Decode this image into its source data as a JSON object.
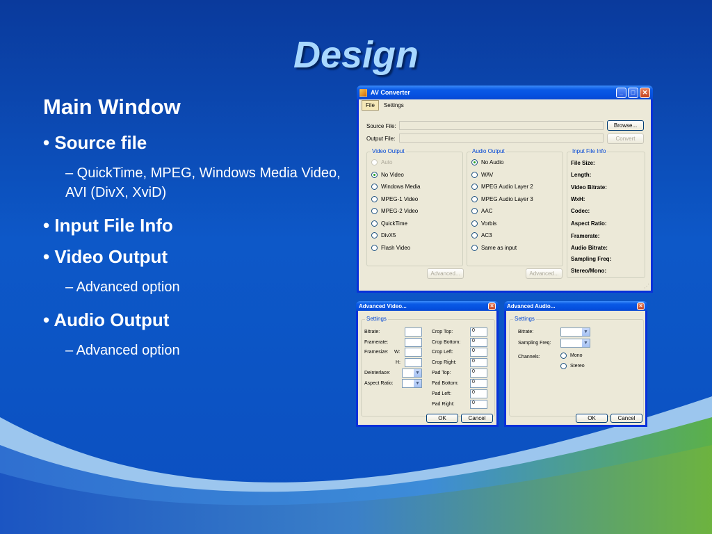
{
  "slide": {
    "title": "Design",
    "heading": "Main Window",
    "bullets": [
      {
        "text": "• Source file",
        "sub": "– QuickTime, MPEG, Windows Media Video, AVI (DivX, XviD)"
      },
      {
        "text": "• Input File Info",
        "sub": ""
      },
      {
        "text": "• Video Output",
        "sub": "– Advanced option"
      },
      {
        "text": "• Audio Output",
        "sub": "– Advanced option"
      }
    ]
  },
  "main_window": {
    "title": "AV Converter",
    "menu": [
      "File",
      "Settings"
    ],
    "source_label": "Source File:",
    "output_label": "Output File:",
    "browse": "Browse...",
    "convert": "Convert",
    "video_group": "Video Output",
    "video_options": [
      "Auto",
      "No Video",
      "Windows Media",
      "MPEG-1 Video",
      "MPEG-2 Video",
      "QuickTime",
      "DivX5",
      "Flash Video"
    ],
    "audio_group": "Audio Output",
    "audio_options": [
      "No Audio",
      "WAV",
      "MPEG Audio Layer 2",
      "MPEG Audio Layer 3",
      "AAC",
      "Vorbis",
      "AC3",
      "Same as input"
    ],
    "advanced": "Advanced...",
    "info_group": "Input File Info",
    "info_fields": [
      "File Size:",
      "Length:",
      "Video Bitrate:",
      "WxH:",
      "Codec:",
      "Aspect Ratio:",
      "Framerate:",
      "Audio Bitrate:",
      "Sampling Freq:",
      "Stereo/Mono:"
    ]
  },
  "adv_video": {
    "title": "Advanced Video...",
    "group": "Settings",
    "bitrate": "Bitrate:",
    "framerate": "Framerate:",
    "framesize": "Framesize:",
    "w": "W:",
    "h": "H:",
    "deinterlace": "Deinterlace:",
    "aspect": "Aspect Ratio:",
    "crop_pad": [
      {
        "label": "Crop Top:",
        "value": "0"
      },
      {
        "label": "Crop Bottom:",
        "value": "0"
      },
      {
        "label": "Crop Left:",
        "value": "0"
      },
      {
        "label": "Crop Right:",
        "value": "0"
      },
      {
        "label": "Pad Top:",
        "value": "0"
      },
      {
        "label": "Pad Bottom:",
        "value": "0"
      },
      {
        "label": "Pad Left:",
        "value": "0"
      },
      {
        "label": "Pad Right:",
        "value": "0"
      }
    ],
    "ok": "OK",
    "cancel": "Cancel"
  },
  "adv_audio": {
    "title": "Advanced Audio...",
    "group": "Settings",
    "bitrate": "Bitrate:",
    "sampling": "Sampling Freq:",
    "channels": "Channels:",
    "mono": "Mono",
    "stereo": "Stereo",
    "ok": "OK",
    "cancel": "Cancel"
  }
}
